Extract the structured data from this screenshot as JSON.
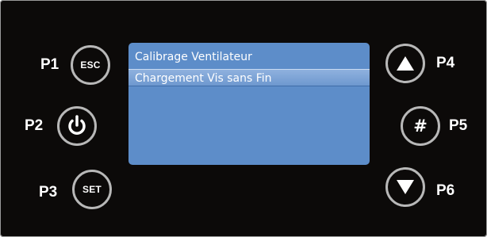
{
  "labels": {
    "p1": "P1",
    "p2": "P2",
    "p3": "P3",
    "p4": "P4",
    "p5": "P5",
    "p6": "P6"
  },
  "buttons": {
    "esc": "ESC",
    "set": "SET",
    "hash": "#",
    "power_icon": "power-icon",
    "up_icon": "triangle-up-icon",
    "down_icon": "triangle-down-icon"
  },
  "screen": {
    "menu_items": [
      "Calibrage Ventilateur",
      "Chargement Vis sans Fin"
    ],
    "selected_index": 1
  },
  "colors": {
    "panel_background": "#0c0a09",
    "screen_background": "#5d8dc9",
    "button_ring": "#b8b8b8",
    "text": "#ffffff"
  }
}
